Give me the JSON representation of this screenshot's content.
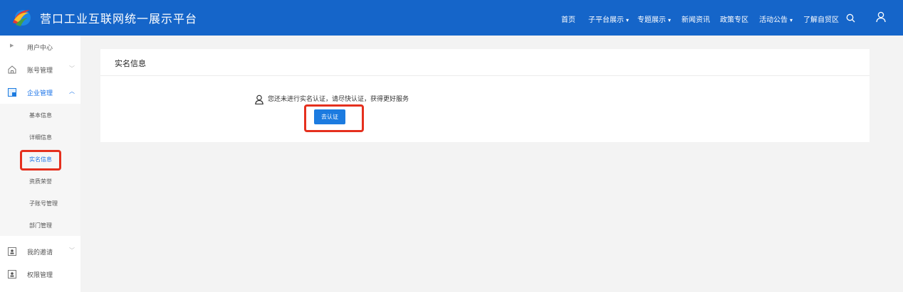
{
  "header": {
    "title": "营口工业互联网统一展示平台",
    "nav": [
      {
        "label": "首页",
        "dropdown": false
      },
      {
        "label": "子平台展示",
        "dropdown": true
      },
      {
        "label": "专题展示",
        "dropdown": true
      },
      {
        "label": "新闻资讯",
        "dropdown": false
      },
      {
        "label": "政策专区",
        "dropdown": false
      },
      {
        "label": "活动公告",
        "dropdown": true
      },
      {
        "label": "了解自贸区",
        "dropdown": false
      }
    ],
    "caret": "▾",
    "icons": [
      "search-icon",
      "user-icon"
    ],
    "color": "#1565c9"
  },
  "sidebar": {
    "top_label": "用户中心",
    "items": [
      {
        "label": "账号管理",
        "icon": "home-icon",
        "expanded": false
      },
      {
        "label": "企业管理",
        "icon": "enterprise-icon",
        "expanded": true,
        "active": true
      },
      {
        "label": "我的邀请",
        "icon": "invite-icon",
        "expanded": false
      },
      {
        "label": "权限管理",
        "icon": "permission-icon",
        "expanded": false
      }
    ],
    "sub_items": [
      {
        "label": "基本信息"
      },
      {
        "label": "详细信息"
      },
      {
        "label": "实名信息",
        "active": true
      },
      {
        "label": "资质荣誉"
      },
      {
        "label": "子账号管理"
      },
      {
        "label": "部门管理"
      }
    ]
  },
  "main": {
    "card_title": "实名信息",
    "notice": "您还未进行实名认证，请尽快认证，获得更好服务",
    "button_label": "去认证"
  },
  "colors": {
    "accent": "#1c7be0",
    "highlight": "#e5301e"
  }
}
